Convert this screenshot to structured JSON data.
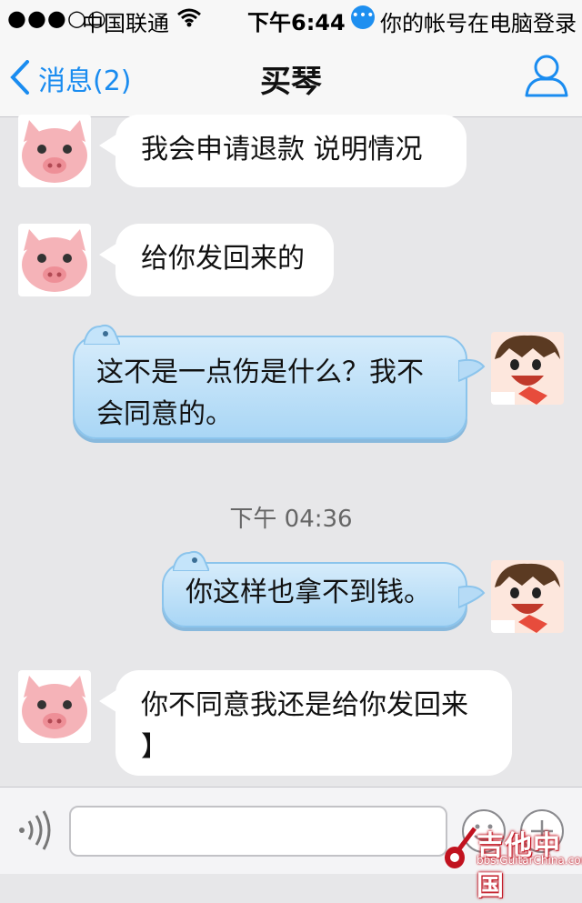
{
  "status_bar": {
    "signal": "●●●○○",
    "carrier": "中国联通",
    "time": "下午6:44",
    "notice": "你的帐号在电脑登录"
  },
  "nav": {
    "back_label": "消息(2)",
    "title": "买琴"
  },
  "messages": [
    {
      "side": "in",
      "text": "我会申请退款 说明情况"
    },
    {
      "side": "in",
      "text": "给你发回来的"
    },
    {
      "side": "out",
      "line1": "这不是一点伤是什么？我不",
      "line2": "会同意的。"
    },
    {
      "timestamp": "下午 04:36"
    },
    {
      "side": "out",
      "text": "你这样也拿不到钱。"
    },
    {
      "side": "in",
      "line1": "你不同意我还是给你发回来",
      "line2": "】"
    }
  ],
  "input": {
    "placeholder": "",
    "value": ""
  },
  "watermark": {
    "main": "吉他中国",
    "url": "bbs.GuitarChina.com"
  },
  "colors": {
    "accent": "#1a8cf0",
    "chat_bg": "#e7e7e9",
    "out_bubble": "#b9ddf7"
  },
  "icons": {
    "back": "chevron-left-icon",
    "profile": "user-icon",
    "voice": "voice-icon",
    "emoji": "emoji-icon",
    "plus": "plus-icon",
    "wifi": "wifi-icon"
  }
}
